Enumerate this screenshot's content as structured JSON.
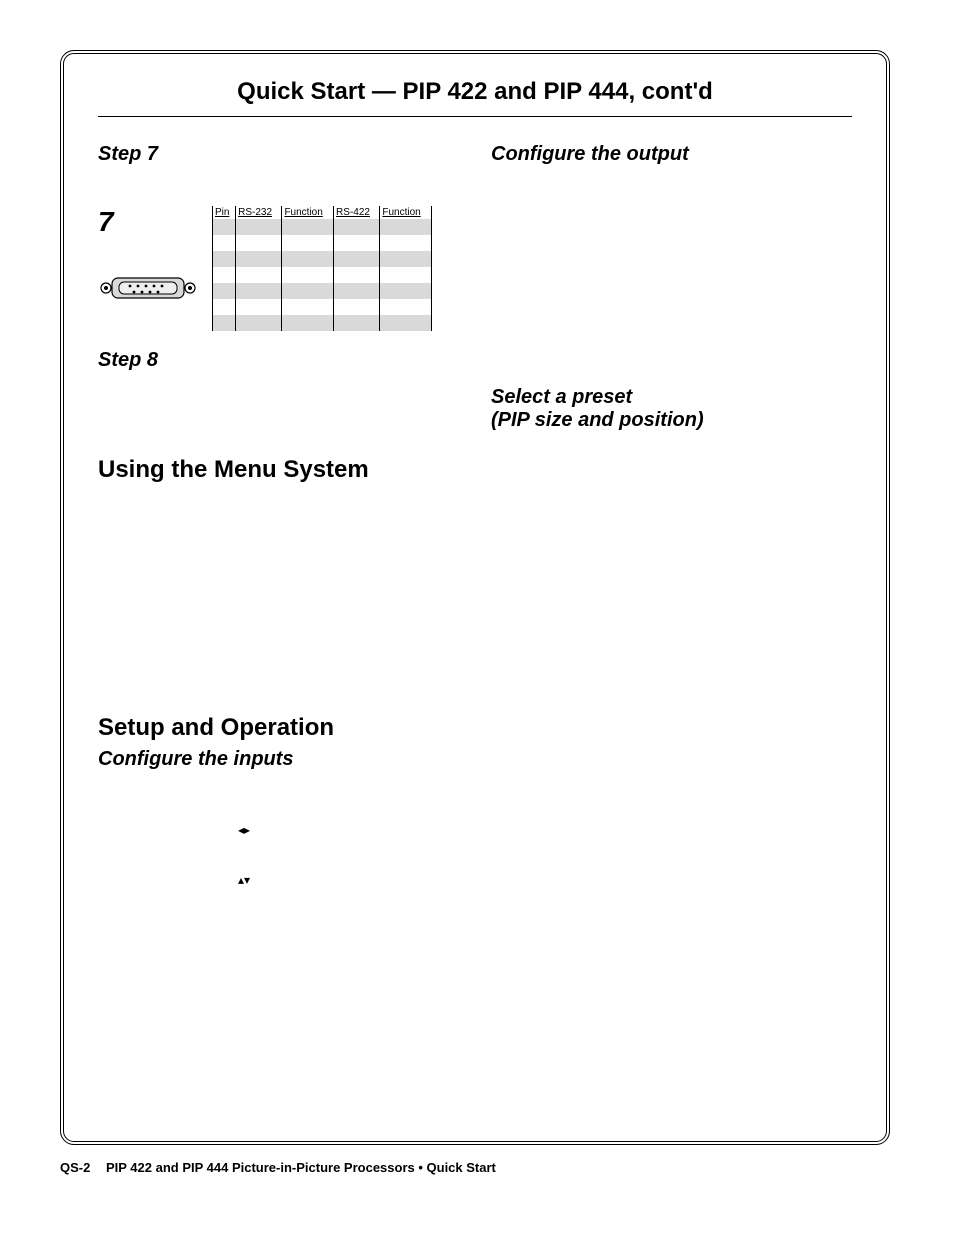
{
  "title": "Quick Start — PIP 422 and PIP 444, cont'd",
  "left": {
    "step7": "Step 7",
    "big7": "7",
    "step8": "Step 8",
    "menuHead": "Using the Menu System",
    "setupHead": "Setup and Operation",
    "configInputs": "Configure the inputs",
    "arrowsLR": "◂▸",
    "arrowsUD": "▴▾"
  },
  "right": {
    "configOutput": "Configure the output",
    "selectPreset1": "Select a preset",
    "selectPreset2": "(PIP size and position)"
  },
  "pinTable": {
    "headers": [
      "Pin",
      "RS-232",
      "Function",
      "RS-422",
      "Function"
    ]
  },
  "footer": {
    "page": "QS-2",
    "text": "PIP 422 and PIP 444 Picture-in-Picture Processors • Quick Start"
  }
}
